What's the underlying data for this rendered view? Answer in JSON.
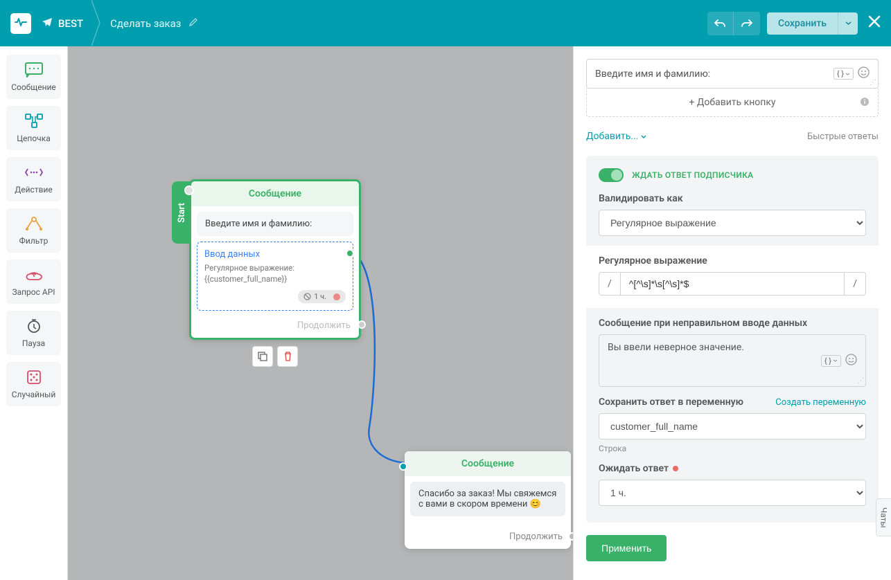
{
  "header": {
    "bot_name": "BEST",
    "flow_name": "Сделать заказ",
    "save_label": "Сохранить"
  },
  "toolbar": {
    "items": [
      {
        "label": "Сообщение",
        "icon": "message"
      },
      {
        "label": "Цепочка",
        "icon": "chain"
      },
      {
        "label": "Действие",
        "icon": "action"
      },
      {
        "label": "Фильтр",
        "icon": "filter"
      },
      {
        "label": "Запрос API",
        "icon": "api"
      },
      {
        "label": "Пауза",
        "icon": "pause"
      },
      {
        "label": "Случайный",
        "icon": "random"
      }
    ]
  },
  "canvas": {
    "start_label": "Start",
    "node1": {
      "title": "Сообщение",
      "message": "Введите имя и фамилию:",
      "data_input_title": "Ввод данных",
      "data_input_sub1": "Регулярное выражение:",
      "data_input_sub2": "{{customer_full_name}}",
      "wait_chip": "1 ч.",
      "continue": "Продолжить"
    },
    "node2": {
      "title": "Сообщение",
      "message": "Спасибо за заказ! Мы свяжемся с вами в скором времени 😊",
      "continue": "Продолжить"
    }
  },
  "panel": {
    "message_text": "Введите имя и фамилию:",
    "add_button_label": "+ Добавить кнопку",
    "add_link": "Добавить...",
    "quick_replies": "Быстрые ответы",
    "wait_toggle_label": "ЖДАТЬ ОТВЕТ ПОДПИСЧИКА",
    "validate_label": "Валидировать как",
    "validate_value": "Регулярное выражение",
    "regex_label": "Регулярное выражение",
    "regex_value": "^[^\\s]*\\s[^\\s]*$",
    "error_msg_label": "Сообщение при неправильном вводе данных",
    "error_msg_value": "Вы ввели неверное значение.",
    "save_var_label": "Сохранить ответ в переменную",
    "create_var_link": "Создать переменную",
    "save_var_value": "customer_full_name",
    "type_help": "Строка",
    "wait_label": "Ожидать ответ",
    "wait_value": "1 ч.",
    "apply_label": "Применить"
  },
  "chat_tab": "Чаты"
}
